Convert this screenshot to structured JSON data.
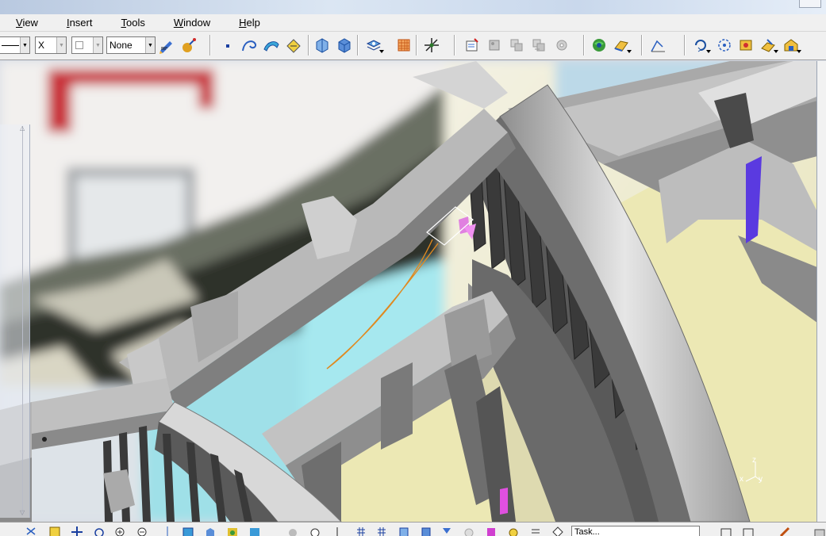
{
  "menubar": {
    "items": [
      {
        "label": "View",
        "mnemonic": "V"
      },
      {
        "label": "Insert",
        "mnemonic": "I"
      },
      {
        "label": "Tools",
        "mnemonic": "T"
      },
      {
        "label": "Window",
        "mnemonic": "W"
      },
      {
        "label": "Help",
        "mnemonic": "H"
      }
    ]
  },
  "toolbar": {
    "line_type_combo": "",
    "point_type_combo": "X",
    "thickness_combo": "",
    "layer_combo": "None",
    "icons": [
      "painter-icon",
      "graphic-properties-icon",
      "point-icon",
      "curve-icon",
      "surface-icon",
      "snap-icon",
      "view-front-icon",
      "view-back-icon",
      "multi-view-icon",
      "grid-icon",
      "compass-icon",
      "create-datum-icon",
      "pattern-icon",
      "array-icon",
      "array2-icon",
      "gear-icon",
      "render-style-icon",
      "diagnose-icon",
      "swap-icon",
      "cycle-icon",
      "fix-icon",
      "plane-icon",
      "select-icon"
    ],
    "accent_color": "#2b6bd6"
  },
  "viewport": {
    "axis_labels": {
      "z": "z",
      "x": "x",
      "y": "y"
    },
    "colors": {
      "frame": "#9a9a9a",
      "frame_dark": "#3e3e3e",
      "selection": "#e0891f",
      "background_yellow": "#ece8b4"
    }
  },
  "bottombar": {
    "command_input": "Task..."
  }
}
